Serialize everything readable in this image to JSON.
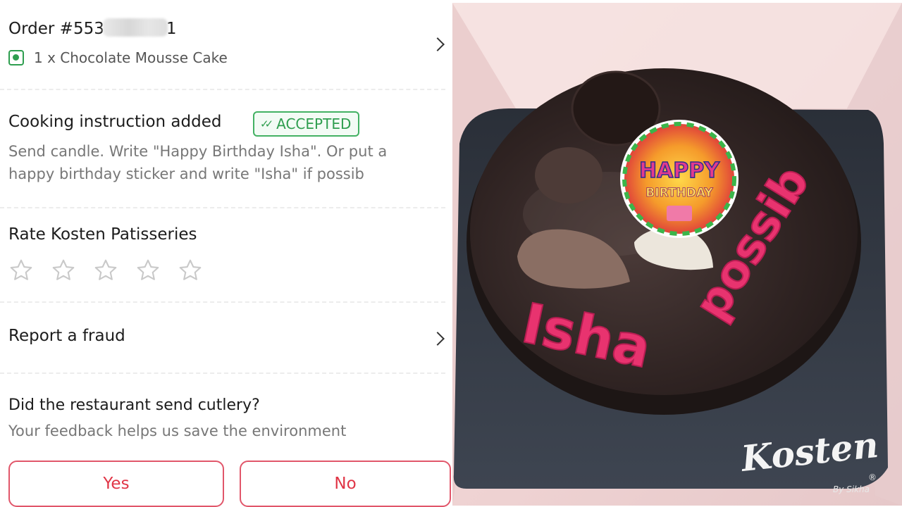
{
  "order": {
    "title_prefix": "Order #553",
    "title_suffix": "1",
    "item": "1 x Chocolate Mousse Cake"
  },
  "cooking": {
    "title": "Cooking instruction added",
    "badge": "ACCEPTED",
    "text": "Send candle. Write \"Happy Birthday Isha\". Or put a\nhappy birthday sticker and write \"Isha\" if possib"
  },
  "rating": {
    "title": "Rate Kosten Patisseries",
    "stars_selected": 0,
    "stars_total": 5
  },
  "fraud": {
    "label": "Report a fraud"
  },
  "cutlery": {
    "question": "Did the restaurant send cutlery?",
    "subtitle": "Your feedback helps us save the environment",
    "yes_label": "Yes",
    "no_label": "No"
  },
  "photo": {
    "cake_text_1": "Isha",
    "cake_text_2": "possib",
    "sticker_line_1": "HAPPY",
    "sticker_line_2": "BIRTHDAY",
    "brand": "Kosten",
    "brand_tagline": "By Sikha",
    "registered": "®"
  },
  "colors": {
    "accent_red": "#e03546",
    "accepted_green": "#2f9e4f",
    "icing_pink": "#e8336f",
    "chocolate": "#2e2220"
  }
}
